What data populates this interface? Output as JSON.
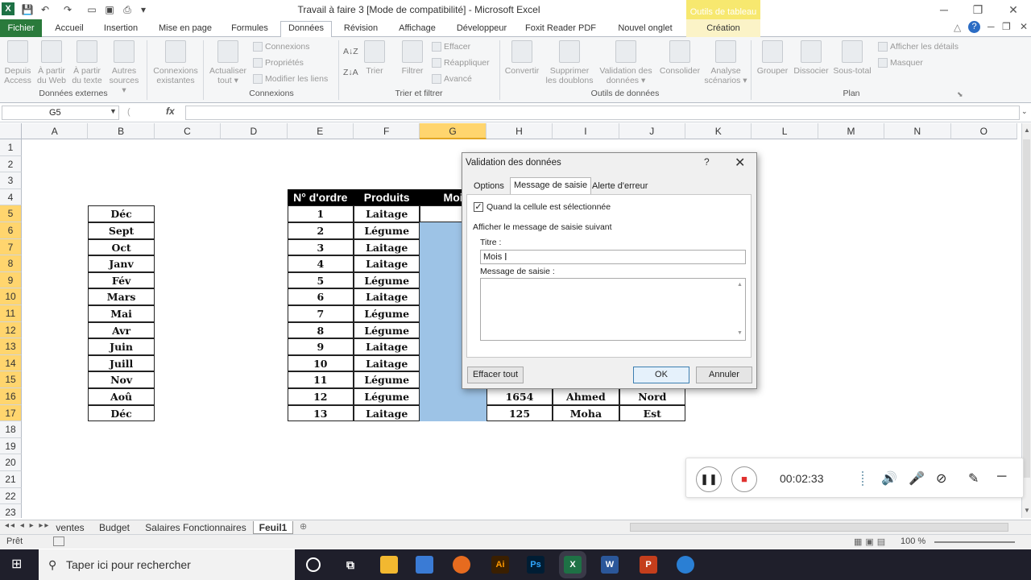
{
  "window": {
    "title": "Travail à faire 3  [Mode de compatibilité]  -  Microsoft Excel",
    "context_tab_title": "Outils de tableau",
    "minimize": "─",
    "restore": "❐",
    "close": "✕"
  },
  "tabs": [
    "Fichier",
    "Accueil",
    "Insertion",
    "Mise en page",
    "Formules",
    "Données",
    "Révision",
    "Affichage",
    "Développeur",
    "Foxit Reader PDF",
    "Nouvel onglet",
    "Création"
  ],
  "ribbon": {
    "ext_data": {
      "b1a": "Depuis",
      "b1b": "Access",
      "b2a": "À partir",
      "b2b": "du Web",
      "b3a": "À partir",
      "b3b": "du texte",
      "b4a": "Autres",
      "b4b": "sources ▾",
      "group": "Données externes"
    },
    "connections": {
      "existing_a": "Connexions",
      "existing_b": "existantes",
      "refresh_a": "Actualiser",
      "refresh_b": "tout ▾",
      "conn": "Connexions",
      "props": "Propriétés",
      "edit_links": "Modifier les liens",
      "group": "Connexions"
    },
    "sort": {
      "asc": "A↓Z",
      "desc": "Z↓A",
      "sort": "Trier",
      "filter": "Filtrer",
      "clear": "Effacer",
      "reapply": "Réappliquer",
      "advanced": "Avancé",
      "group": "Trier et filtrer"
    },
    "tools": {
      "convert": "Convertir",
      "dup_a": "Supprimer",
      "dup_b": "les doublons",
      "valid_a": "Validation des",
      "valid_b": "données ▾",
      "consol": "Consolider",
      "scen_a": "Analyse",
      "scen_b": "scénarios ▾",
      "group": "Outils de données"
    },
    "outline": {
      "group_btn": "Grouper",
      "ungroup": "Dissocier",
      "subtotal": "Sous-total",
      "show": "Afficher les détails",
      "hide": "Masquer",
      "group": "Plan"
    }
  },
  "formula_bar": {
    "name_box": "G5",
    "fx": "fx",
    "formula": ""
  },
  "columns": [
    "A",
    "B",
    "C",
    "D",
    "E",
    "F",
    "G",
    "H",
    "I",
    "J",
    "K",
    "L",
    "M",
    "N",
    "O"
  ],
  "rows": [
    "1",
    "2",
    "3",
    "4",
    "5",
    "6",
    "7",
    "8",
    "9",
    "10",
    "11",
    "12",
    "13",
    "14",
    "15",
    "16",
    "17",
    "18",
    "19",
    "20",
    "21",
    "22",
    "23"
  ],
  "months": [
    "Déc",
    "Sept",
    "Oct",
    "Janv",
    "Fév",
    "Mars",
    "Mai",
    "Avr",
    "Juin",
    "Juill",
    "Nov",
    "Aoû",
    "Déc"
  ],
  "table": {
    "headers": [
      "N° d'ordre",
      "Produits",
      "Moi"
    ],
    "numbers": [
      "1",
      "2",
      "3",
      "4",
      "5",
      "6",
      "7",
      "8",
      "9",
      "10",
      "11",
      "12",
      "13"
    ],
    "products": [
      "Laitage",
      "Légume",
      "Laitage",
      "Laitage",
      "Légume",
      "Laitage",
      "Légume",
      "Légume",
      "Laitage",
      "Laitage",
      "Légume",
      "Légume",
      "Laitage"
    ],
    "extra_rows": [
      {
        "h": "1654",
        "i": "Ahmed",
        "j": "Nord"
      },
      {
        "h": "125",
        "i": "Moha",
        "j": "Est"
      }
    ]
  },
  "sheets": [
    "ventes",
    "Budget",
    "Salaires Fonctionnaires",
    "Feuil1"
  ],
  "status": {
    "ready": "Prêt",
    "zoom": "100 %"
  },
  "taskbar": {
    "search_placeholder": "Taper ici pour rechercher"
  },
  "dialog": {
    "title": "Validation des données",
    "help": "?",
    "close": "✕",
    "tabs": [
      "Options",
      "Message de saisie",
      "Alerte d'erreur"
    ],
    "checkbox_label": "Quand la cellule est sélectionnée",
    "checkbox_checked": true,
    "section_label": "Afficher le message de saisie suivant",
    "title_label": "Titre :",
    "title_value": "Mois",
    "message_label": "Message de saisie :",
    "message_value": "",
    "clear_button": "Effacer tout",
    "ok_button": "OK",
    "cancel_button": "Annuler"
  },
  "recorder": {
    "time": "00:02:33"
  }
}
